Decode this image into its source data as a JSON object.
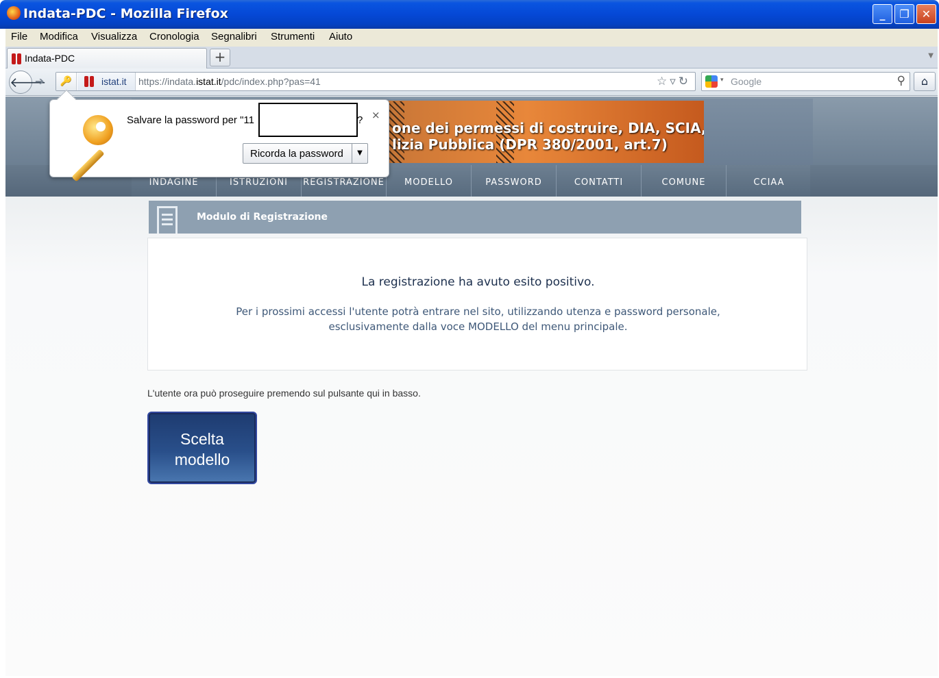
{
  "window": {
    "title": "Indata-PDC - Mozilla Firefox"
  },
  "menu": [
    "File",
    "Modifica",
    "Visualizza",
    "Cronologia",
    "Segnalibri",
    "Strumenti",
    "Aiuto"
  ],
  "tab": {
    "label": "Indata-PDC",
    "new_tab": "+"
  },
  "nav": {
    "identity": "istat.it",
    "url_prefix": "https://indata.",
    "url_domain": "istat.it",
    "url_suffix": "/pdc/index.php?pas=41",
    "search_placeholder": "Google"
  },
  "popup": {
    "question": "Salvare la password per \"11",
    "question_end": "?",
    "close": "×",
    "remember_label": "Ricorda la password",
    "dropdown": "▼"
  },
  "banner": {
    "line1": "one dei permessi di costruire, DIA, SCIA,",
    "line2": "lizia Pubblica (DPR 380/2001, art.7)"
  },
  "site_nav": [
    "INDAGINE",
    "ISTRUZIONI",
    "REGISTRAZIONE",
    "MODELLO",
    "PASSWORD",
    "CONTATTI",
    "COMUNE",
    "CCIAA"
  ],
  "section": {
    "title": "Modulo di Registrazione"
  },
  "message": {
    "headline": "La registrazione ha avuto esito positivo.",
    "line1": "Per i prossimi accessi l'utente potrà entrare nel sito, utilizzando utenza e password personale,",
    "line2": "esclusivamente dalla voce MODELLO del menu principale."
  },
  "hint": "L'utente ora può proseguire premendo sul pulsante qui in basso.",
  "button": {
    "line1": "Scelta",
    "line2": "modello"
  }
}
